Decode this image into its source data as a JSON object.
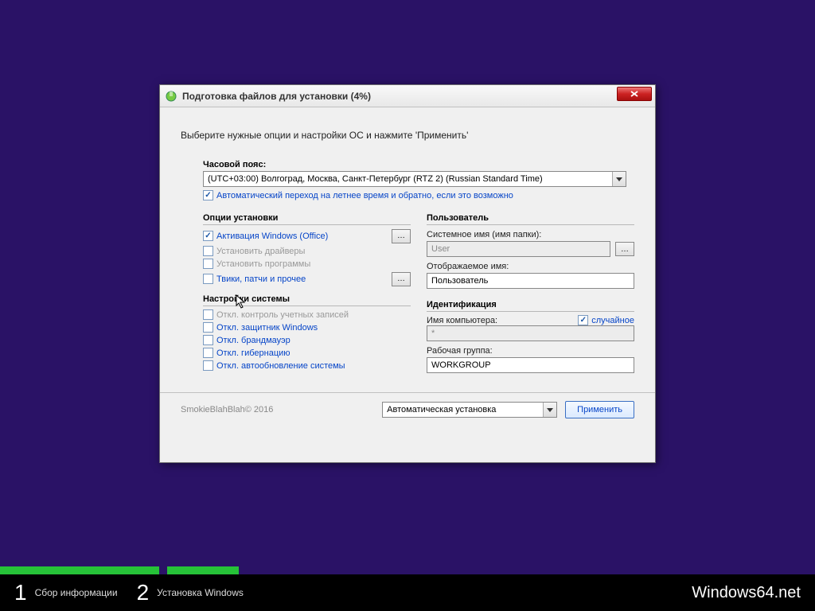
{
  "title": "Подготовка файлов для установки (4%)",
  "instruction": "Выберите нужные опции и настройки ОС и нажмите 'Применить'",
  "timezone": {
    "label": "Часовой пояс:",
    "value": "(UTC+03:00) Волгоград, Москва, Санкт-Петербург (RTZ 2) (Russian Standard Time)",
    "dst_label": "Автоматический переход на летнее время и обратно, если это возможно"
  },
  "install_options": {
    "title": "Опции установки",
    "activation": "Активация Windows (Office)",
    "drivers": "Установить драйверы",
    "programs": "Установить программы",
    "tweaks": "Твики, патчи и прочее"
  },
  "system_settings": {
    "title": "Настройки системы",
    "uac": "Откл. контроль учетных записей",
    "defender": "Откл. защитник Windows",
    "firewall": "Откл. брандмауэр",
    "hibernate": "Откл. гибернацию",
    "autoupdate": "Откл. автообновление системы"
  },
  "user": {
    "title": "Пользователь",
    "sysname_label": "Системное имя (имя папки):",
    "sysname_value": "User",
    "dispname_label": "Отображаемое имя:",
    "dispname_value": "Пользователь"
  },
  "ident": {
    "title": "Идентификация",
    "computer_label": "Имя компьютера:",
    "random_label": "случайное",
    "computer_value": "*",
    "workgroup_label": "Рабочая группа:",
    "workgroup_value": "WORKGROUP"
  },
  "footer": {
    "copyright": "SmokieBlahBlah© 2016",
    "install_mode": "Автоматическая установка",
    "apply": "Применить"
  },
  "bottom": {
    "step1": "Сбор информации",
    "step2": "Установка Windows",
    "brand": "Windows64.net"
  }
}
